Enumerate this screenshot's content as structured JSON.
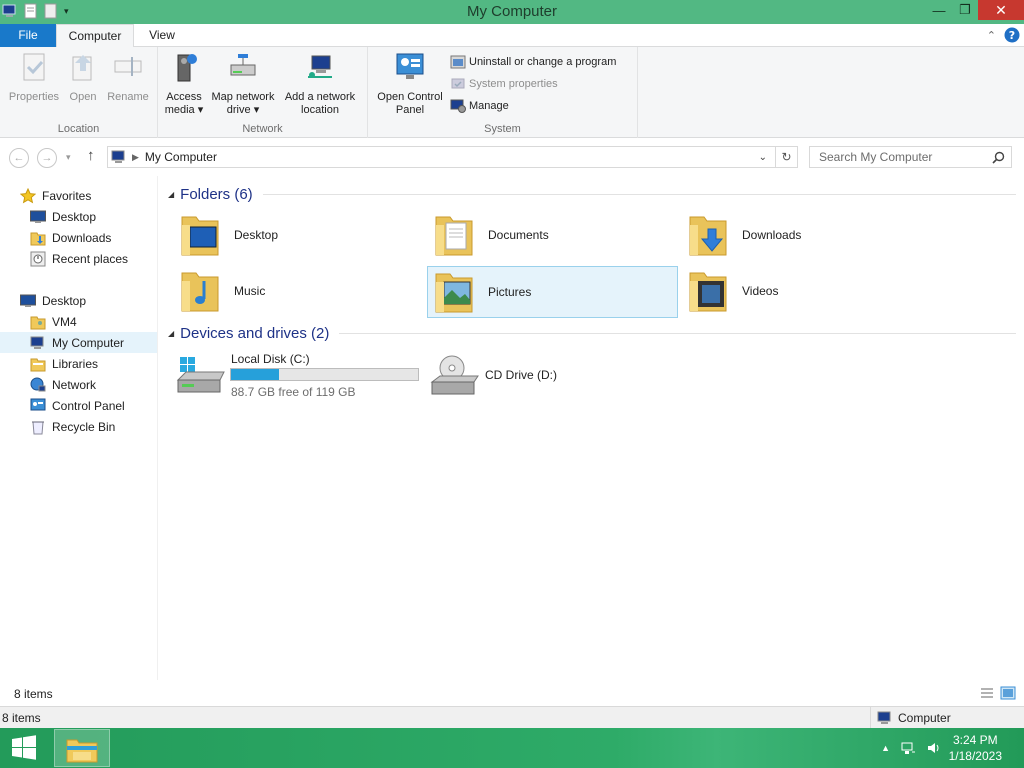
{
  "window": {
    "title": "My Computer"
  },
  "ribbon_tabs": {
    "file": "File",
    "computer": "Computer",
    "view": "View"
  },
  "ribbon": {
    "location": {
      "label": "Location",
      "properties": "Properties",
      "open": "Open",
      "rename": "Rename"
    },
    "network": {
      "label": "Network",
      "access_media_1": "Access",
      "access_media_2": "media",
      "map_drive_1": "Map network",
      "map_drive_2": "drive",
      "add_location_1": "Add a network",
      "add_location_2": "location"
    },
    "system": {
      "label": "System",
      "open_cp_1": "Open Control",
      "open_cp_2": "Panel",
      "uninstall": "Uninstall or change a program",
      "system_properties": "System properties",
      "manage": "Manage"
    }
  },
  "address": {
    "path": "My Computer"
  },
  "search": {
    "placeholder": "Search My Computer"
  },
  "nav": {
    "favorites": "Favorites",
    "fav_desktop": "Desktop",
    "fav_downloads": "Downloads",
    "fav_recent": "Recent places",
    "desktop": "Desktop",
    "vm4": "VM4",
    "my_computer": "My Computer",
    "libraries": "Libraries",
    "network": "Network",
    "control_panel": "Control Panel",
    "recycle_bin": "Recycle Bin"
  },
  "folders": {
    "header": "Folders (6)",
    "items": [
      "Desktop",
      "Documents",
      "Downloads",
      "Music",
      "Pictures",
      "Videos"
    ]
  },
  "drives": {
    "header": "Devices and drives (2)",
    "c": {
      "name": "Local Disk (C:)",
      "free": "88.7 GB free of 119 GB",
      "used_fraction": 0.255
    },
    "d": {
      "name": "CD Drive (D:)"
    }
  },
  "status": {
    "items": "8 items"
  },
  "infobar": {
    "items": "8 items",
    "location": "Computer"
  },
  "taskbar": {
    "time": "3:24 PM",
    "date": "1/18/2023"
  }
}
